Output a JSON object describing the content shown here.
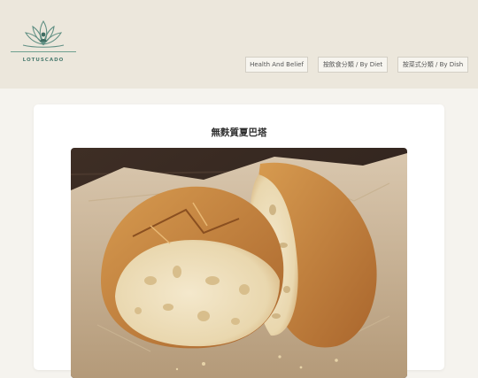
{
  "brand": {
    "name": "LOTUSCADO",
    "logo_icon": "lotus-icon"
  },
  "nav": {
    "items": [
      {
        "label": "Health And Belief"
      },
      {
        "label": "按飲食分類 / By Diet"
      },
      {
        "label": "按菜式分類 / By Dish"
      }
    ]
  },
  "article": {
    "title": "無麩質夏巴塔",
    "image_subject": "loaf-of-bread"
  },
  "colors": {
    "header_bg": "#ece7dc",
    "page_bg": "#f5f3ee",
    "brand_accent": "#4e7e72"
  }
}
